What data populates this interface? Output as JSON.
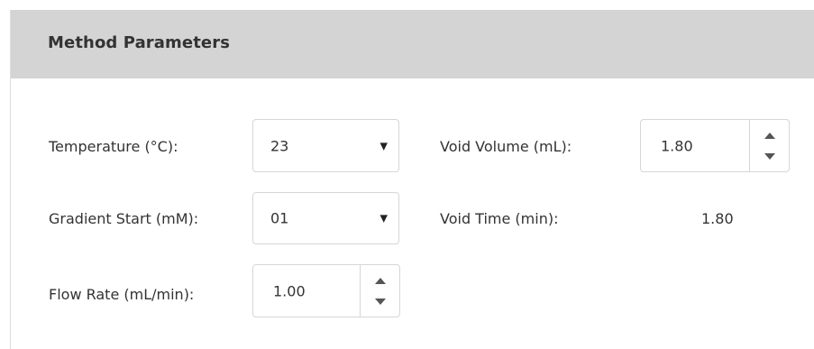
{
  "panel": {
    "title": "Method Parameters"
  },
  "fields": {
    "temperature": {
      "label": "Temperature (°C):",
      "value": "23"
    },
    "gradient_start": {
      "label": "Gradient Start (mM):",
      "value": "01"
    },
    "flow_rate": {
      "label": "Flow Rate (mL/min):",
      "value": "1.00"
    },
    "void_volume": {
      "label": "Void Volume (mL):",
      "value": "1.80"
    },
    "void_time": {
      "label": "Void Time (min):",
      "value": "1.80"
    }
  },
  "icons": {
    "dropdown": "caret-down-icon",
    "spin_up": "spin-up-icon",
    "spin_down": "spin-down-icon"
  }
}
